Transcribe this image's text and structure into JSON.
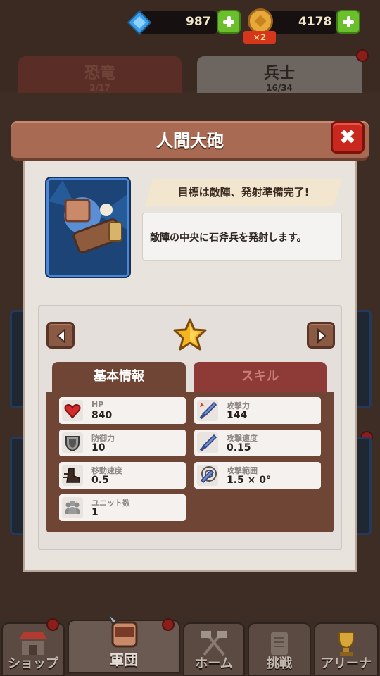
{
  "header": {
    "gem_count": "987",
    "gold_count": "4178",
    "boost_badge": "×2"
  },
  "background_tabs": [
    {
      "label": "恐竜",
      "count": "2/17"
    },
    {
      "label": "兵士",
      "count": "16/34"
    }
  ],
  "modal": {
    "title": "人間大砲",
    "close_symbol": "✖",
    "tagline": "目標は敵陣、発射準備完了!",
    "description": "敵陣の中央に石斧兵を発射します。",
    "tabs": {
      "basic": "基本情報",
      "skill": "スキル"
    },
    "stats": [
      {
        "label": "HP",
        "value": "840",
        "icon": "heart-icon"
      },
      {
        "label": "攻撃力",
        "value": "144",
        "icon": "sword-icon"
      },
      {
        "label": "防御力",
        "value": "10",
        "icon": "shield-icon"
      },
      {
        "label": "攻撃速度",
        "value": "0.15",
        "icon": "sword-icon"
      },
      {
        "label": "移動速度",
        "value": "0.5",
        "icon": "boot-icon"
      },
      {
        "label": "攻撃範囲",
        "value": "1.5 × 0°",
        "icon": "target-icon"
      },
      {
        "label": "ユニット数",
        "value": "1",
        "icon": "group-icon"
      }
    ]
  },
  "bottom_nav": [
    {
      "label": "ショップ",
      "icon": "shop-icon"
    },
    {
      "label": "軍団",
      "icon": "legion-icon"
    },
    {
      "label": "ホーム",
      "icon": "axes-icon"
    },
    {
      "label": "挑戦",
      "icon": "scroll-icon"
    },
    {
      "label": "アリーナ",
      "icon": "trophy-icon"
    }
  ],
  "colors": {
    "modal_header": "#a86a52",
    "close_button": "#c8281e",
    "plus_button": "#6bbf2c",
    "portrait_border": "#4c86d6",
    "active_tab": "#6f4636",
    "inactive_tab": "#8e3a37"
  }
}
